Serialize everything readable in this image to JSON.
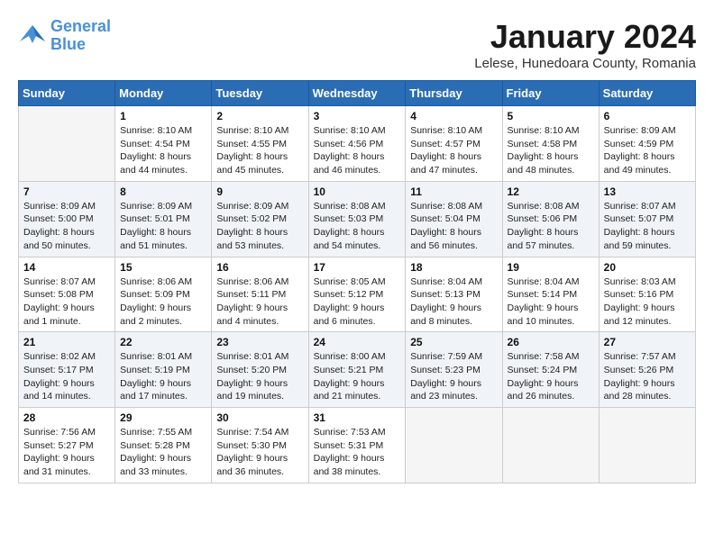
{
  "logo": {
    "line1": "General",
    "line2": "Blue"
  },
  "title": "January 2024",
  "subtitle": "Lelese, Hunedoara County, Romania",
  "days_header": [
    "Sunday",
    "Monday",
    "Tuesday",
    "Wednesday",
    "Thursday",
    "Friday",
    "Saturday"
  ],
  "weeks": [
    [
      {
        "num": "",
        "info": ""
      },
      {
        "num": "1",
        "info": "Sunrise: 8:10 AM\nSunset: 4:54 PM\nDaylight: 8 hours\nand 44 minutes."
      },
      {
        "num": "2",
        "info": "Sunrise: 8:10 AM\nSunset: 4:55 PM\nDaylight: 8 hours\nand 45 minutes."
      },
      {
        "num": "3",
        "info": "Sunrise: 8:10 AM\nSunset: 4:56 PM\nDaylight: 8 hours\nand 46 minutes."
      },
      {
        "num": "4",
        "info": "Sunrise: 8:10 AM\nSunset: 4:57 PM\nDaylight: 8 hours\nand 47 minutes."
      },
      {
        "num": "5",
        "info": "Sunrise: 8:10 AM\nSunset: 4:58 PM\nDaylight: 8 hours\nand 48 minutes."
      },
      {
        "num": "6",
        "info": "Sunrise: 8:09 AM\nSunset: 4:59 PM\nDaylight: 8 hours\nand 49 minutes."
      }
    ],
    [
      {
        "num": "7",
        "info": "Sunrise: 8:09 AM\nSunset: 5:00 PM\nDaylight: 8 hours\nand 50 minutes."
      },
      {
        "num": "8",
        "info": "Sunrise: 8:09 AM\nSunset: 5:01 PM\nDaylight: 8 hours\nand 51 minutes."
      },
      {
        "num": "9",
        "info": "Sunrise: 8:09 AM\nSunset: 5:02 PM\nDaylight: 8 hours\nand 53 minutes."
      },
      {
        "num": "10",
        "info": "Sunrise: 8:08 AM\nSunset: 5:03 PM\nDaylight: 8 hours\nand 54 minutes."
      },
      {
        "num": "11",
        "info": "Sunrise: 8:08 AM\nSunset: 5:04 PM\nDaylight: 8 hours\nand 56 minutes."
      },
      {
        "num": "12",
        "info": "Sunrise: 8:08 AM\nSunset: 5:06 PM\nDaylight: 8 hours\nand 57 minutes."
      },
      {
        "num": "13",
        "info": "Sunrise: 8:07 AM\nSunset: 5:07 PM\nDaylight: 8 hours\nand 59 minutes."
      }
    ],
    [
      {
        "num": "14",
        "info": "Sunrise: 8:07 AM\nSunset: 5:08 PM\nDaylight: 9 hours\nand 1 minute."
      },
      {
        "num": "15",
        "info": "Sunrise: 8:06 AM\nSunset: 5:09 PM\nDaylight: 9 hours\nand 2 minutes."
      },
      {
        "num": "16",
        "info": "Sunrise: 8:06 AM\nSunset: 5:11 PM\nDaylight: 9 hours\nand 4 minutes."
      },
      {
        "num": "17",
        "info": "Sunrise: 8:05 AM\nSunset: 5:12 PM\nDaylight: 9 hours\nand 6 minutes."
      },
      {
        "num": "18",
        "info": "Sunrise: 8:04 AM\nSunset: 5:13 PM\nDaylight: 9 hours\nand 8 minutes."
      },
      {
        "num": "19",
        "info": "Sunrise: 8:04 AM\nSunset: 5:14 PM\nDaylight: 9 hours\nand 10 minutes."
      },
      {
        "num": "20",
        "info": "Sunrise: 8:03 AM\nSunset: 5:16 PM\nDaylight: 9 hours\nand 12 minutes."
      }
    ],
    [
      {
        "num": "21",
        "info": "Sunrise: 8:02 AM\nSunset: 5:17 PM\nDaylight: 9 hours\nand 14 minutes."
      },
      {
        "num": "22",
        "info": "Sunrise: 8:01 AM\nSunset: 5:19 PM\nDaylight: 9 hours\nand 17 minutes."
      },
      {
        "num": "23",
        "info": "Sunrise: 8:01 AM\nSunset: 5:20 PM\nDaylight: 9 hours\nand 19 minutes."
      },
      {
        "num": "24",
        "info": "Sunrise: 8:00 AM\nSunset: 5:21 PM\nDaylight: 9 hours\nand 21 minutes."
      },
      {
        "num": "25",
        "info": "Sunrise: 7:59 AM\nSunset: 5:23 PM\nDaylight: 9 hours\nand 23 minutes."
      },
      {
        "num": "26",
        "info": "Sunrise: 7:58 AM\nSunset: 5:24 PM\nDaylight: 9 hours\nand 26 minutes."
      },
      {
        "num": "27",
        "info": "Sunrise: 7:57 AM\nSunset: 5:26 PM\nDaylight: 9 hours\nand 28 minutes."
      }
    ],
    [
      {
        "num": "28",
        "info": "Sunrise: 7:56 AM\nSunset: 5:27 PM\nDaylight: 9 hours\nand 31 minutes."
      },
      {
        "num": "29",
        "info": "Sunrise: 7:55 AM\nSunset: 5:28 PM\nDaylight: 9 hours\nand 33 minutes."
      },
      {
        "num": "30",
        "info": "Sunrise: 7:54 AM\nSunset: 5:30 PM\nDaylight: 9 hours\nand 36 minutes."
      },
      {
        "num": "31",
        "info": "Sunrise: 7:53 AM\nSunset: 5:31 PM\nDaylight: 9 hours\nand 38 minutes."
      },
      {
        "num": "",
        "info": ""
      },
      {
        "num": "",
        "info": ""
      },
      {
        "num": "",
        "info": ""
      }
    ]
  ]
}
